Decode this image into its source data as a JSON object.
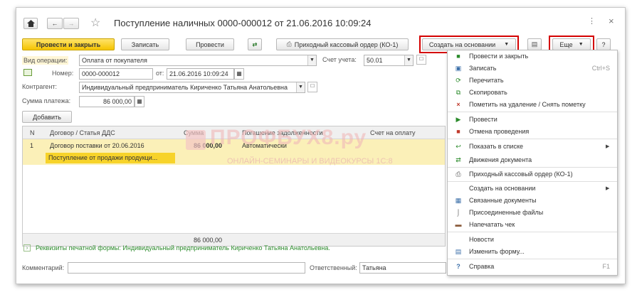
{
  "window": {
    "title": "Поступление наличных 0000-000012 от 21.06.2016 10:09:24"
  },
  "toolbar": {
    "post_close": "Провести и закрыть",
    "save": "Записать",
    "post": "Провести",
    "cash_order": "Приходный кассовый ордер (КО-1)",
    "create_basis": "Создать на основании",
    "more": "Еще",
    "help": "?"
  },
  "form": {
    "op_type_label": "Вид операции:",
    "op_type_value": "Оплата от покупателя",
    "account_label": "Счет учета:",
    "account_value": "50.01",
    "number_label": "Номер:",
    "number_value": "0000-000012",
    "date_label": "от:",
    "date_value": "21.06.2016 10:09:24",
    "counterparty_label": "Контрагент:",
    "counterparty_value": "Индивидуальный предприниматель Кириченко Татьяна Анатольевна",
    "amount_label": "Сумма платежа:",
    "amount_value": "86 000,00",
    "add_button": "Добавить"
  },
  "table": {
    "headers": [
      "N",
      "Договор / Статья ДДС",
      "Сумма",
      "Погашение задолженности",
      "Счет на оплату"
    ],
    "rows": [
      {
        "n": "1",
        "contract": "Договор поставки от 20.06.2016",
        "sum": "86 000,00",
        "repay": "Автоматически",
        "invoice": "",
        "sub": "Поступление от продажи продукци..."
      }
    ],
    "total": "86 000,00"
  },
  "print_req": "Реквизиты печатной формы: Индивидуальный предприниматель Кириченко Татьяна Анатольевна.",
  "footer": {
    "comment_label": "Комментарий:",
    "comment_value": "",
    "responsible_label": "Ответственный:",
    "responsible_value": "Татьяна"
  },
  "watermark": {
    "title": "ПРОФБУХ8.ру",
    "subtitle": "ОНЛАЙН-СЕМИНАРЫ И ВИДЕОКУРСЫ 1С:8"
  },
  "menu": {
    "items": [
      {
        "label": "Провести и закрыть",
        "shortcut": "",
        "icon": "post-close-icon"
      },
      {
        "label": "Записать",
        "shortcut": "Ctrl+S",
        "icon": "save-icon"
      },
      {
        "label": "Перечитать",
        "shortcut": "",
        "icon": "reread-icon"
      },
      {
        "label": "Скопировать",
        "shortcut": "",
        "icon": "copy-icon"
      },
      {
        "label": "Пометить на удаление / Снять пометку",
        "shortcut": "",
        "icon": "delete-mark-icon"
      },
      {
        "label": "Провести",
        "shortcut": "",
        "icon": "post-icon"
      },
      {
        "label": "Отмена проведения",
        "shortcut": "",
        "icon": "unpost-icon"
      },
      {
        "label": "Показать в списке",
        "shortcut": "",
        "icon": "show-list-icon"
      },
      {
        "label": "Движения документа",
        "shortcut": "",
        "icon": "movements-icon"
      },
      {
        "label": "Приходный кассовый ордер (КО-1)",
        "shortcut": "",
        "icon": "print-icon"
      },
      {
        "label": "Создать на основании",
        "shortcut": "",
        "icon": ""
      },
      {
        "label": "Связанные документы",
        "shortcut": "",
        "icon": "related-docs-icon"
      },
      {
        "label": "Присоединенные файлы",
        "shortcut": "",
        "icon": "attachment-icon"
      },
      {
        "label": "Напечатать чек",
        "shortcut": "",
        "icon": "receipt-icon"
      },
      {
        "label": "Новости",
        "shortcut": "",
        "icon": ""
      },
      {
        "label": "Изменить форму...",
        "shortcut": "",
        "icon": "edit-form-icon"
      },
      {
        "label": "Справка",
        "shortcut": "F1",
        "icon": "help-icon"
      }
    ]
  }
}
